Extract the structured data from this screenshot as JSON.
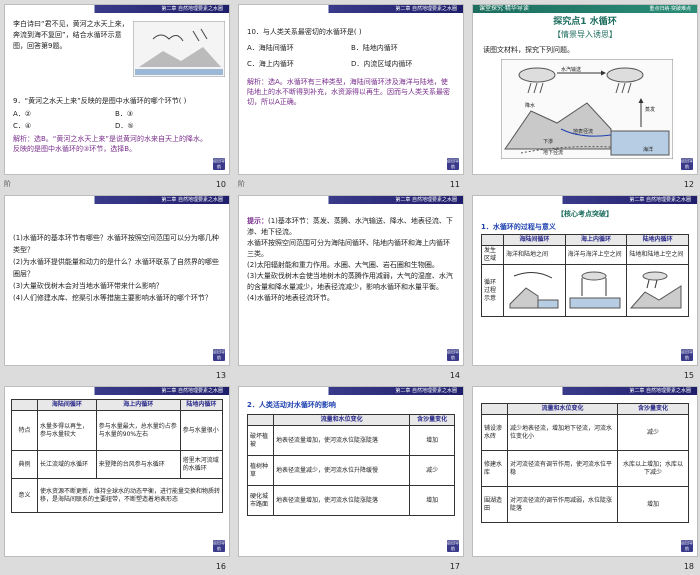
{
  "slides": [
    {
      "num": "10",
      "header": "第二章 自然地理要素之水圈",
      "intro": "李白诗曰“君不见，黄河之水天上来，奔流到海不复回”，结合水循环示意图，回答第9题。",
      "question": "9．“黄河之水天上来”反映的是图中水循环的哪个环节(    )",
      "options": [
        "A．②",
        "B．③",
        "C．④",
        "D．⑤"
      ],
      "answer": "解析：选B。“黄河之水天上来”是说黄河的水来自天上的降水。反映的是图中水循环的③环节，选择B。",
      "corner_label": "阶"
    },
    {
      "num": "11",
      "header": "第二章 自然地理要素之水圈",
      "question": "10．与人类关系最密切的水循环是(    )",
      "options": [
        "A．海陆间循环",
        "B．陆地内循环",
        "C．海上内循环",
        "D．内流区域内循环"
      ],
      "answer": "解析：选A。水循环有三种类型，海陆间循环涉及海洋与陆地，使陆地上的水不断得到补充，水资源得以再生。因而与人类关系最密切，所以A正确。",
      "corner_label": "阶"
    },
    {
      "num": "12",
      "header_left": "课堂探究·精华导读",
      "header_right": "重点归纳·突破难点",
      "title": "探究点1  水循环",
      "subtitle": "【情景导入诱思】",
      "lead": "读图文材料，探究下列问题。",
      "diagram_labels": [
        "降水",
        "水汽输送",
        "蒸发",
        "地表径流",
        "下渗",
        "地下径流",
        "海洋"
      ]
    },
    {
      "num": "13",
      "header": "第二章 自然地理要素之水圈",
      "questions": [
        "(1)水循环的基本环节有哪些？水循环按照空间范围可以分为哪几种类型？",
        "(2)为水循环提供能量和动力的是什么？水循环联系了自然界的哪些圈层？",
        "(3)大量砍伐树木会对当地水循环带来什么影响？",
        "(4)人们修建水库、挖渠引水等措施主要影响水循环的哪个环节？"
      ]
    },
    {
      "num": "14",
      "header": "第二章 自然地理要素之水圈",
      "label": "提示：",
      "answers": [
        "(1)基本环节：蒸发、蒸腾、水汽输送、降水、地表径流、下渗、地下径流。",
        "水循环按照空间范围可分为海陆间循环、陆地内循环和海上内循环三类。",
        "(2)太阳辐射能和重力作用。水圈、大气圈、岩石圈和生物圈。",
        "(3)大量砍伐树木会使当地树木的蒸腾作用减弱，大气的湿度、水汽的含量和降水量减少，地表径流减少，影响水循环和水量平衡。",
        "(4)水循环的地表径流环节。"
      ]
    },
    {
      "num": "15",
      "header": "第二章 自然地理要素之水圈",
      "tag": "【核心考点突破】",
      "section": "1．水循环的过程与意义",
      "table_headers": [
        "",
        "海陆间循环",
        "海上内循环",
        "陆地内循环"
      ],
      "row1": [
        "发生区域",
        "海洋和陆地之间",
        "海洋与海洋上空之间",
        "陆地和陆地上空之间"
      ],
      "row2_label": "循环过程示意"
    },
    {
      "num": "16",
      "header": "第二章 自然地理要素之水圈",
      "table_headers": [
        "",
        "海陆间循环",
        "海上内循环",
        "陆地内循环"
      ],
      "rows": [
        [
          "特点",
          "水量多得以再生，参与水量较大",
          "参与水量最大，总水量约占参与水量的90%左右",
          "参与水量很小"
        ],
        [
          "典例",
          "长江流域的水循环",
          "来登降的台风参与水循环",
          "塔里木河流域的水循环"
        ],
        [
          "意义",
          "使水资源不断更新，维持全球水的动态平衡，进行能量交换和物质转移，是海陆间联系的主要纽带，不断塑造着地表形态",
          "",
          ""
        ]
      ]
    },
    {
      "num": "17",
      "header": "第二章 自然地理要素之水圈",
      "section": "2．人类活动对水循环的影响",
      "table_headers": [
        "",
        "流量和水位变化",
        "含沙量变化"
      ],
      "rows": [
        [
          "破坏植被",
          "地表径流量增加，使河流水位陡涨陡落",
          "增加"
        ],
        [
          "植树种草",
          "地表径流量减少，使河流水位升降缓慢",
          "减少"
        ],
        [
          "硬化城市路面",
          "地表径流量增加，使河流水位陡涨陡落",
          "增加"
        ]
      ]
    },
    {
      "num": "18",
      "header": "第二章 自然地理要素之水圈",
      "table_headers": [
        "",
        "流量和水位变化",
        "含沙量变化"
      ],
      "rows": [
        [
          "铺设渗水砖",
          "减少地表径流，增加地下径流，河流水位变化小",
          "减少"
        ],
        [
          "修建水库",
          "对河流径流有调节作用，使河流水位平稳",
          "水库以上增加；水库以下减少"
        ],
        [
          "围湖造田",
          "对河流径流的调节作用减弱，水位陡涨陡落",
          "增加"
        ]
      ]
    }
  ],
  "back_label": "返回导航"
}
